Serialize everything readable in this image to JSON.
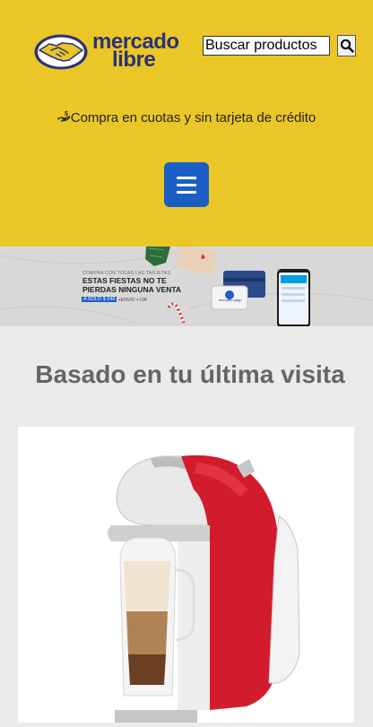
{
  "header": {
    "logo": {
      "line1": "mercado",
      "line2": "libre"
    },
    "search": {
      "placeholder": "Buscar productos",
      "icon": "search-icon"
    },
    "promo_text": "Compra en cuotas y sin tarjeta de crédito",
    "menu_icon": "hamburger-menu-icon"
  },
  "banner": {
    "small_text": "COMPRA CON TODAS LAS TARJETAS",
    "headline_line1": "ESTAS FIESTAS NO TE",
    "headline_line2": "PIERDAS NINGUNA VENTA",
    "price": "A SOLO $ 249",
    "price_note": "+ENVÍO + IVA",
    "reader_label": "mercado pago"
  },
  "recommendations": {
    "title": "Basado en tu última visita",
    "product_image": "dolce-gusto-coffee-machine-red"
  },
  "colors": {
    "brand_yellow": "#eac727",
    "brand_blue": "#2d3277",
    "menu_blue": "#1b5fc6",
    "background": "#ebebeb"
  }
}
